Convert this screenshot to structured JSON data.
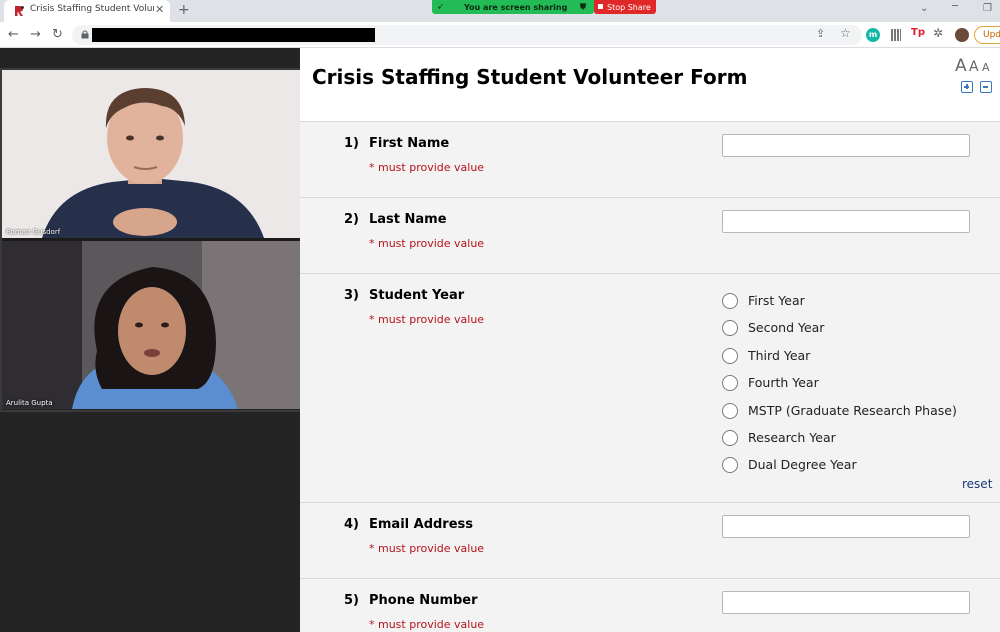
{
  "browser": {
    "tab_title": "Crisis Staffing Student Volunteer",
    "tab_close": "✕",
    "new_tab": "+",
    "screen_sharing_text": "You are screen sharing",
    "stop_share_label": "Stop Share",
    "update_label": "Upda"
  },
  "participants": [
    {
      "name": "Roman Gusdorf"
    },
    {
      "name": "Arulita Gupta"
    }
  ],
  "form": {
    "title": "Crisis Staffing Student Volunteer Form",
    "text_size_glyphs": [
      "A",
      "A",
      "A"
    ],
    "required_text": "* must provide value",
    "reset_label": "reset",
    "questions": [
      {
        "number": "1)",
        "label": "First Name",
        "required": "* must provide value",
        "value": ""
      },
      {
        "number": "2)",
        "label": "Last Name",
        "required": "* must provide value",
        "value": ""
      },
      {
        "number": "3)",
        "label": "Student Year",
        "required": "* must provide value",
        "options": [
          "First Year",
          "Second Year",
          "Third Year",
          "Fourth Year",
          "MSTP (Graduate Research Phase)",
          "Research Year",
          "Dual Degree Year"
        ]
      },
      {
        "number": "4)",
        "label": "Email Address",
        "required": "* must provide value",
        "value": ""
      },
      {
        "number": "5)",
        "label": "Phone Number",
        "required": "* must provide value",
        "value": ""
      }
    ]
  },
  "icons": {
    "favicon": "redcap-favicon-icon",
    "lock": "lock-icon",
    "share": "share-page-icon",
    "star": "bookmark-star-icon",
    "extensions": "puzzle-icon"
  },
  "colors": {
    "required_red": "#b3131b",
    "share_green": "#22bb55",
    "stop_red": "#e02828",
    "link_blue": "#1a3a78"
  }
}
